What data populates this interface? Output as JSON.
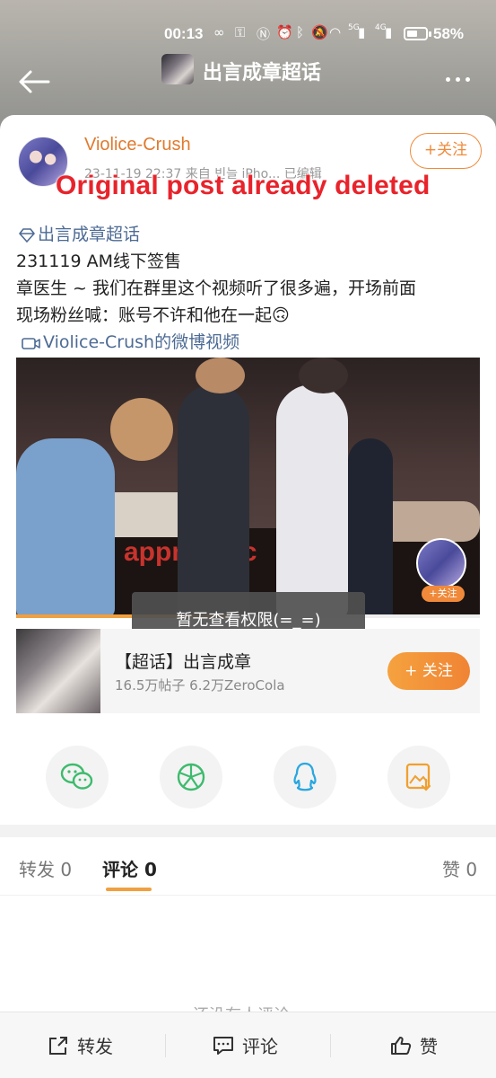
{
  "status_bar": {
    "time": "00:13",
    "network_5g": "5G",
    "network_4g": "4G",
    "battery_percent": "58%"
  },
  "nav": {
    "title": "出言成章超话"
  },
  "post": {
    "username": "Violice-Crush",
    "meta": "23-11-19 22:37  来自 빈늘 iPho...  已编辑",
    "follow_label": "+关注",
    "deleted_overlay": "Original post already deleted",
    "topic_tag": "出言成章超话",
    "line1": "231119 AM线下签售",
    "line2": "章医生 ~ 我们在群里这个视频听了很多遍，开场前面",
    "line3": "现场粉丝喊：账号不许和他在一起🙃",
    "video_link": "Violice-Crush的微博视频",
    "video_banner": "appm usic",
    "watermark_follow": "+关注",
    "toast": "暂无查看权限(=_=)",
    "video_progress": 0.46
  },
  "super_topic": {
    "title": "【超话】出言成章",
    "stats": "16.5万帖子 6.2万ZeroCola",
    "follow_label": "+ 关注"
  },
  "share_icons": [
    "wechat-icon",
    "moments-icon",
    "qq-icon",
    "save-image-icon"
  ],
  "tabs": {
    "repost": "转发 0",
    "comment": "评论 0",
    "like": "赞 0"
  },
  "empty_comments": "还没有人评论",
  "bottom_bar": {
    "repost": "转发",
    "comment": "评论",
    "like": "赞"
  },
  "colors": {
    "accent": "#f08a3a",
    "link": "#4d6b94",
    "deleted_overlay": "#e8232b"
  }
}
